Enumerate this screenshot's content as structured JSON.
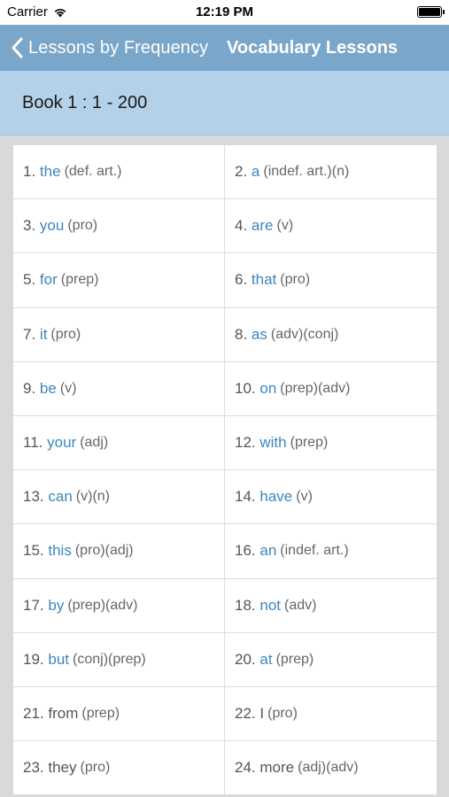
{
  "status_bar": {
    "carrier": "Carrier",
    "time": "12:19 PM"
  },
  "nav": {
    "back_label": "Lessons by Frequency",
    "title": "Vocabulary Lessons"
  },
  "section": {
    "title": "Book 1 : 1 - 200"
  },
  "colors": {
    "nav_bar": "#7aa6c9",
    "section_header": "#b3d1e8",
    "word_link": "#3d86bd",
    "background": "#d9d9d9"
  },
  "words": [
    {
      "num": "1.",
      "word": "the",
      "pos": "(def. art.)"
    },
    {
      "num": "2.",
      "word": "a",
      "pos": "(indef. art.)(n)"
    },
    {
      "num": "3.",
      "word": "you",
      "pos": "(pro)"
    },
    {
      "num": "4.",
      "word": "are",
      "pos": "(v)"
    },
    {
      "num": "5.",
      "word": "for",
      "pos": "(prep)"
    },
    {
      "num": "6.",
      "word": "that",
      "pos": "(pro)"
    },
    {
      "num": "7.",
      "word": "it",
      "pos": "(pro)"
    },
    {
      "num": "8.",
      "word": "as",
      "pos": "(adv)(conj)"
    },
    {
      "num": "9.",
      "word": "be",
      "pos": "(v)"
    },
    {
      "num": "10.",
      "word": "on",
      "pos": "(prep)(adv)"
    },
    {
      "num": "11.",
      "word": "your",
      "pos": "(adj)"
    },
    {
      "num": "12.",
      "word": "with",
      "pos": "(prep)"
    },
    {
      "num": "13.",
      "word": "can",
      "pos": "(v)(n)"
    },
    {
      "num": "14.",
      "word": "have",
      "pos": "(v)"
    },
    {
      "num": "15.",
      "word": "this",
      "pos": "(pro)(adj)"
    },
    {
      "num": "16.",
      "word": "an",
      "pos": "(indef. art.)"
    },
    {
      "num": "17.",
      "word": "by",
      "pos": "(prep)(adv)"
    },
    {
      "num": "18.",
      "word": "not",
      "pos": "(adv)"
    },
    {
      "num": "19.",
      "word": "but",
      "pos": "(conj)(prep)"
    },
    {
      "num": "20.",
      "word": "at",
      "pos": "(prep)"
    },
    {
      "num": "21.",
      "word": "from",
      "pos": "(prep)",
      "plain": true
    },
    {
      "num": "22.",
      "word": "I",
      "pos": "(pro)",
      "plain": true
    },
    {
      "num": "23.",
      "word": "they",
      "pos": "(pro)",
      "plain": true
    },
    {
      "num": "24.",
      "word": "more",
      "pos": "(adj)(adv)",
      "plain": true
    }
  ]
}
